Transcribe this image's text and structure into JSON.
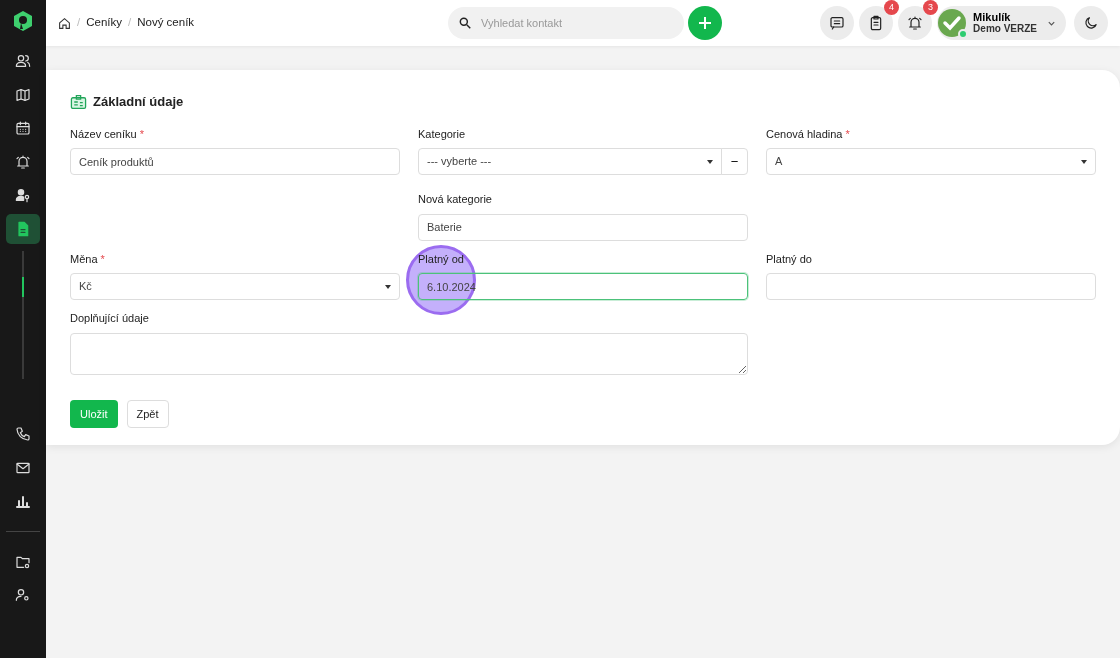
{
  "sidebar": {
    "items": [
      {
        "kind": "contacts",
        "selected": false
      },
      {
        "kind": "map",
        "selected": false
      },
      {
        "kind": "calendar",
        "selected": false
      },
      {
        "kind": "alarm",
        "selected": false
      },
      {
        "kind": "user-key",
        "selected": false
      },
      {
        "kind": "document",
        "selected": true
      },
      {
        "kind": "phone",
        "selected": false
      },
      {
        "kind": "mail",
        "selected": false
      },
      {
        "kind": "chart",
        "selected": false
      },
      {
        "kind": "folder-settings",
        "selected": false
      },
      {
        "kind": "user-settings",
        "selected": false
      }
    ]
  },
  "breadcrumb": [
    {
      "separator": "/",
      "label": "Ceníky"
    },
    {
      "separator": "/",
      "label": "Nový ceník"
    }
  ],
  "search": {
    "placeholder": "Vyhledat kontakt"
  },
  "header_buttons": [
    {
      "kind": "chat"
    },
    {
      "kind": "clipboard",
      "badge": "4"
    },
    {
      "kind": "alarm",
      "badge": "3"
    }
  ],
  "user": {
    "name": "Mikulík",
    "subtitle": "Demo VERZE",
    "online": true
  },
  "form": {
    "title": "Základní údaje",
    "fields": [
      {
        "kind": "text",
        "label": "Název ceníku",
        "required_mark": "*",
        "value": "Ceník produktů",
        "focused": false
      },
      {
        "kind": "select",
        "label": "Kategorie",
        "value": "--- vyberte ---",
        "focused": false,
        "remove_button": "−",
        "new_category": {
          "label": "Nová kategorie",
          "value": "Baterie"
        }
      },
      {
        "kind": "select",
        "label": "Cenová hladina",
        "required_mark": "*",
        "value": "A",
        "focused": false
      },
      {
        "kind": "select",
        "label": "Měna",
        "required_mark": "*",
        "value": "Kč",
        "focused": false
      },
      {
        "kind": "text",
        "label": "Platný od",
        "value": "6.10.2024",
        "focused": true,
        "clicked": true
      },
      {
        "kind": "text",
        "label": "Platný do",
        "focused": false
      },
      {
        "kind": "textarea",
        "label": "Doplňující údaje"
      }
    ],
    "buttons": [
      {
        "kind": "primary",
        "label": "Uložit"
      },
      {
        "kind": "secondary",
        "label": "Zpět"
      }
    ]
  }
}
